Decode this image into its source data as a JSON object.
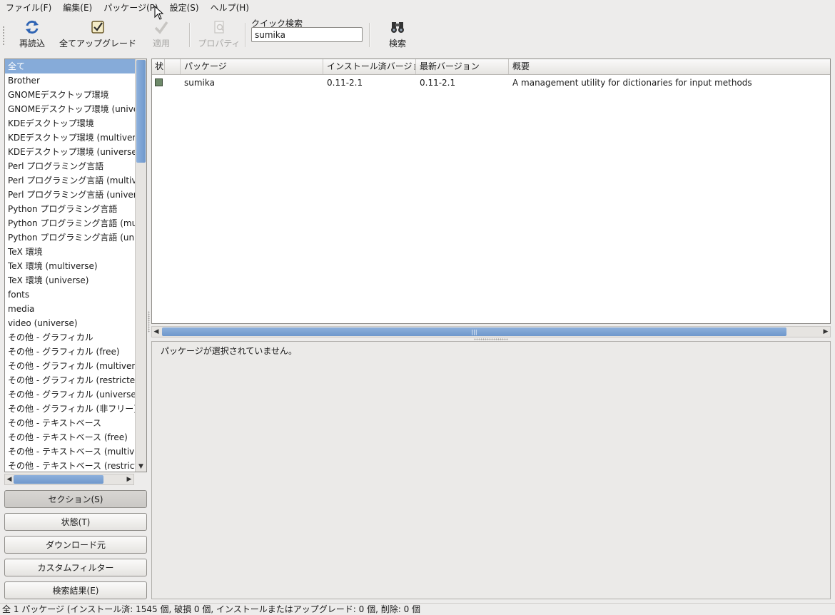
{
  "menubar": {
    "items": [
      {
        "label": "ファイル(F)"
      },
      {
        "label": "編集(E)"
      },
      {
        "label": "パッケージ(P)"
      },
      {
        "label": "設定(S)"
      },
      {
        "label": "ヘルプ(H)"
      }
    ]
  },
  "toolbar": {
    "reload_label": "再読込",
    "upgrade_all_label": "全てアップグレード",
    "apply_label": "適用",
    "properties_label": "プロパティ",
    "quick_search_label": "クイック検索",
    "quick_search_value": "sumika",
    "search_label": "検索"
  },
  "sections": {
    "items": [
      {
        "label": "全て"
      },
      {
        "label": "Brother"
      },
      {
        "label": "GNOMEデスクトップ環境"
      },
      {
        "label": "GNOMEデスクトップ環境 (universe)"
      },
      {
        "label": "KDEデスクトップ環境"
      },
      {
        "label": "KDEデスクトップ環境 (multiverse)"
      },
      {
        "label": "KDEデスクトップ環境 (universe)"
      },
      {
        "label": "Perl プログラミング言語"
      },
      {
        "label": "Perl プログラミング言語 (multiverse)"
      },
      {
        "label": "Perl プログラミング言語 (universe)"
      },
      {
        "label": "Python プログラミング言語"
      },
      {
        "label": "Python プログラミング言語 (multiverse)"
      },
      {
        "label": "Python プログラミング言語 (universe)"
      },
      {
        "label": "TeX 環境"
      },
      {
        "label": "TeX 環境 (multiverse)"
      },
      {
        "label": "TeX 環境 (universe)"
      },
      {
        "label": "fonts"
      },
      {
        "label": "media"
      },
      {
        "label": "video (universe)"
      },
      {
        "label": "その他 - グラフィカル"
      },
      {
        "label": "その他 - グラフィカル (free)"
      },
      {
        "label": "その他 - グラフィカル (multiverse)"
      },
      {
        "label": "その他 - グラフィカル (restricted)"
      },
      {
        "label": "その他 - グラフィカル (universe)"
      },
      {
        "label": "その他 - グラフィカル (非フリー)"
      },
      {
        "label": "その他 - テキストベース"
      },
      {
        "label": "その他 - テキストベース (free)"
      },
      {
        "label": "その他 - テキストベース (multiverse)"
      },
      {
        "label": "その他 - テキストベース (restricted)"
      }
    ],
    "selected_index": 0
  },
  "filters": {
    "section_label": "セクション(S)",
    "status_label": "状態(T)",
    "origin_label": "ダウンロード元",
    "custom_label": "カスタムフィルター",
    "search_results_label": "検索結果(E)"
  },
  "packages": {
    "columns": [
      "状",
      "",
      "パッケージ",
      "インストール済バージョン",
      "最新バージョン",
      "概要"
    ],
    "rows": [
      {
        "name": "sumika",
        "installed": "0.11-2.1",
        "latest": "0.11-2.1",
        "description": "A management utility for dictionaries for input methods",
        "status_color": "#6e8a6a"
      }
    ]
  },
  "details": {
    "message": "パッケージが選択されていません。"
  },
  "statusbar": {
    "text": "全 1 パッケージ (インストール済: 1545 個, 破損 0 個, インストールまたはアップグレード: 0 個, 削除: 0 個"
  },
  "colors": {
    "selection": "#86abd9",
    "scroll_thumb": "#7aa2d4"
  }
}
